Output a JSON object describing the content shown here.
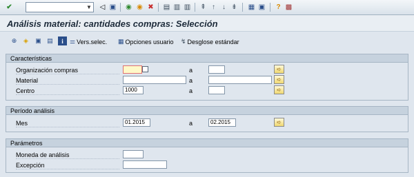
{
  "system_toolbar": {
    "command_field_value": "",
    "icons": [
      "enter-icon",
      "save-icon",
      "back-icon",
      "exit-icon",
      "cancel-icon",
      "print-icon",
      "find-icon",
      "find-next-icon",
      "first-page-icon",
      "prev-page-icon",
      "next-page-icon",
      "last-page-icon",
      "new-session-icon",
      "shortcut-icon",
      "help-icon",
      "customize-icon"
    ]
  },
  "title": "Análisis material: cantidades compras: Selección",
  "app_toolbar": {
    "vers_selec": "Vers.selec.",
    "opciones_usuario": "Opciones usuario",
    "desglose_estandar": "Desglose estándar"
  },
  "caracteristicas": {
    "heading": "Características",
    "rows": [
      {
        "label": "Organización compras",
        "from": "",
        "to_label": "a",
        "to": ""
      },
      {
        "label": "Material",
        "from": "",
        "to_label": "a",
        "to": ""
      },
      {
        "label": "Centro",
        "from": "1000",
        "to_label": "a",
        "to": ""
      }
    ]
  },
  "periodo": {
    "heading": "Período análisis",
    "rows": [
      {
        "label": "Mes",
        "from": "01.2015",
        "to_label": "a",
        "to": "02.2015"
      }
    ]
  },
  "parametros": {
    "heading": "Parámetros",
    "rows": [
      {
        "label": "Moneda de análisis",
        "value": ""
      },
      {
        "label": "Excepción",
        "value": ""
      }
    ]
  }
}
